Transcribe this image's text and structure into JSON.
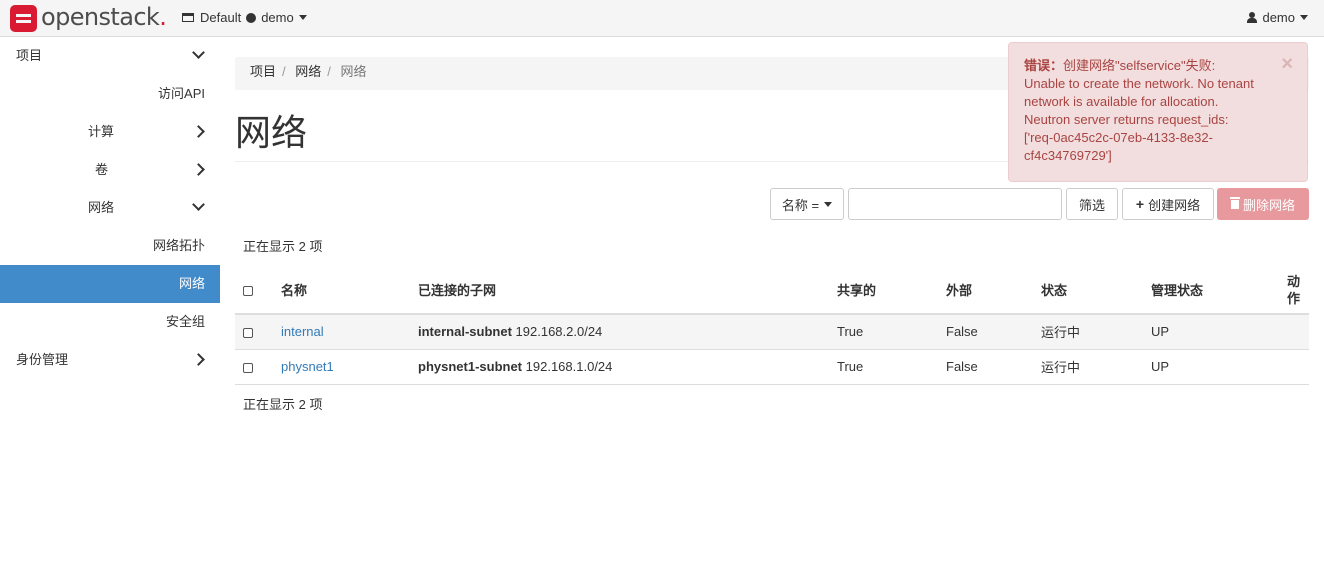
{
  "brand": {
    "name": "openstack",
    "dot": "."
  },
  "topbar": {
    "domain": "Default",
    "project": "demo",
    "user": "demo"
  },
  "sidebar": {
    "project": "项目",
    "api_access": "访问API",
    "compute": "计算",
    "volumes": "卷",
    "network": "网络",
    "network_topology": "网络拓扑",
    "networks": "网络",
    "security_groups": "安全组",
    "identity": "身份管理"
  },
  "breadcrumb": [
    "项目",
    "网络",
    "网络"
  ],
  "page_title": "网络",
  "filter": {
    "field_label": "名称 =",
    "search_value": "",
    "filter_button": "筛选",
    "create_button": "创建网络",
    "delete_button": "删除网络"
  },
  "count_text": "正在显示 2 项",
  "table": {
    "headers": [
      "名称",
      "已连接的子网",
      "共享的",
      "外部",
      "状态",
      "管理状态",
      "动作"
    ],
    "rows": [
      {
        "name": "internal",
        "subnet_name": "internal-subnet",
        "subnet_cidr": "192.168.2.0/24",
        "shared": "True",
        "external": "False",
        "status": "运行中",
        "admin_state": "UP"
      },
      {
        "name": "physnet1",
        "subnet_name": "physnet1-subnet",
        "subnet_cidr": "192.168.1.0/24",
        "shared": "True",
        "external": "False",
        "status": "运行中",
        "admin_state": "UP"
      }
    ]
  },
  "alert": {
    "prefix": "错误：",
    "line1": "创建网络\"selfservice\"失败:",
    "line2": "Unable to create the network. No tenant",
    "line3": "network is available for allocation.",
    "line4": "Neutron server returns request_ids:",
    "line5": "['req-0ac45c2c-07eb-4133-8e32-",
    "line6": "cf4c34769729']",
    "close": "×"
  }
}
